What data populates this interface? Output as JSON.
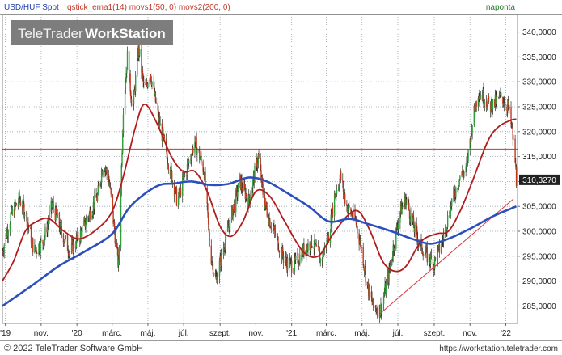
{
  "chart_data": {
    "type": "candlestick",
    "header": {
      "instrument": "USD/HUF Spot",
      "indicators": "qstick_ema1(14) movs1(50, 0) movs2(200, 0)",
      "period": "naponta"
    },
    "watermark": {
      "brand": "TeleTrader",
      "product": "WorkStation"
    },
    "footer": {
      "copyright": "© 2022 TeleTrader Software GmbH",
      "url": "https://workstation.teletrader.com"
    },
    "ylim": [
      281.5,
      343.5
    ],
    "yticks": [
      {
        "value": 285,
        "label": "285,0000"
      },
      {
        "value": 290,
        "label": "290,0000"
      },
      {
        "value": 295,
        "label": "295,0000"
      },
      {
        "value": 300,
        "label": "300,0000"
      },
      {
        "value": 305,
        "label": "305,0000"
      },
      {
        "value": 310,
        "label": "310,0000"
      },
      {
        "value": 315,
        "label": "315,0000"
      },
      {
        "value": 320,
        "label": "320,0000"
      },
      {
        "value": 325,
        "label": "325,0000"
      },
      {
        "value": 330,
        "label": "330,0000"
      },
      {
        "value": 335,
        "label": "335,0000"
      },
      {
        "value": 340,
        "label": "340,0000"
      }
    ],
    "xlim": [
      "2019-08-27",
      "2022-01-21"
    ],
    "xticks": [
      {
        "date": "2019-09-01",
        "label": "'19"
      },
      {
        "date": "2019-11-01",
        "label": "nov."
      },
      {
        "date": "2020-01-01",
        "label": "'20"
      },
      {
        "date": "2020-03-01",
        "label": "márc."
      },
      {
        "date": "2020-05-01",
        "label": "máj."
      },
      {
        "date": "2020-07-01",
        "label": "júl."
      },
      {
        "date": "2020-09-01",
        "label": "szept."
      },
      {
        "date": "2020-11-01",
        "label": "nov."
      },
      {
        "date": "2021-01-01",
        "label": "'21"
      },
      {
        "date": "2021-03-01",
        "label": "márc."
      },
      {
        "date": "2021-05-01",
        "label": "máj."
      },
      {
        "date": "2021-07-01",
        "label": "júl."
      },
      {
        "date": "2021-09-01",
        "label": "szept."
      },
      {
        "date": "2021-11-01",
        "label": "nov."
      },
      {
        "date": "2022-01-01",
        "label": "'22"
      }
    ],
    "last_price": {
      "value": 310.327,
      "label": "310,3270"
    },
    "horizontal_line": {
      "value": 316.5,
      "color": "#c0392b"
    },
    "trendline": {
      "points": [
        [
          "2021-06-01",
          283.5
        ],
        [
          "2022-01-14",
          306.5
        ]
      ],
      "color": "#d9383a"
    },
    "price_path": [
      [
        "2019-08-27",
        296.0
      ],
      [
        "2019-09-10",
        303.0
      ],
      [
        "2019-09-25",
        306.5
      ],
      [
        "2019-10-05",
        304.0
      ],
      [
        "2019-10-20",
        296.0
      ],
      [
        "2019-11-05",
        298.0
      ],
      [
        "2019-11-20",
        305.5
      ],
      [
        "2019-12-05",
        300.0
      ],
      [
        "2019-12-20",
        296.0
      ],
      [
        "2020-01-05",
        299.0
      ],
      [
        "2020-01-20",
        303.0
      ],
      [
        "2020-02-05",
        307.0
      ],
      [
        "2020-02-15",
        314.0
      ],
      [
        "2020-02-25",
        310.0
      ],
      [
        "2020-03-05",
        300.0
      ],
      [
        "2020-03-12",
        293.0
      ],
      [
        "2020-03-20",
        325.0
      ],
      [
        "2020-03-27",
        335.0
      ],
      [
        "2020-04-05",
        324.0
      ],
      [
        "2020-04-15",
        337.0
      ],
      [
        "2020-04-25",
        328.0
      ],
      [
        "2020-05-05",
        332.0
      ],
      [
        "2020-05-20",
        322.0
      ],
      [
        "2020-06-05",
        314.0
      ],
      [
        "2020-06-20",
        306.0
      ],
      [
        "2020-07-05",
        312.0
      ],
      [
        "2020-07-20",
        318.0
      ],
      [
        "2020-08-05",
        312.0
      ],
      [
        "2020-08-15",
        296.0
      ],
      [
        "2020-08-25",
        290.0
      ],
      [
        "2020-09-05",
        296.0
      ],
      [
        "2020-09-20",
        303.0
      ],
      [
        "2020-10-05",
        310.0
      ],
      [
        "2020-10-20",
        306.0
      ],
      [
        "2020-11-05",
        315.0
      ],
      [
        "2020-11-15",
        306.0
      ],
      [
        "2020-11-25",
        302.0
      ],
      [
        "2020-12-05",
        299.0
      ],
      [
        "2020-12-20",
        294.0
      ],
      [
        "2021-01-05",
        293.0
      ],
      [
        "2021-01-20",
        296.0
      ],
      [
        "2021-02-05",
        298.0
      ],
      [
        "2021-02-20",
        294.0
      ],
      [
        "2021-03-05",
        299.0
      ],
      [
        "2021-03-15",
        307.0
      ],
      [
        "2021-03-25",
        311.0
      ],
      [
        "2021-04-05",
        305.0
      ],
      [
        "2021-04-20",
        302.0
      ],
      [
        "2021-05-01",
        296.0
      ],
      [
        "2021-05-10",
        289.0
      ],
      [
        "2021-05-20",
        285.0
      ],
      [
        "2021-06-01",
        284.0
      ],
      [
        "2021-06-15",
        291.0
      ],
      [
        "2021-06-25",
        298.0
      ],
      [
        "2021-07-05",
        304.0
      ],
      [
        "2021-07-15",
        306.5
      ],
      [
        "2021-07-25",
        302.0
      ],
      [
        "2021-08-05",
        298.0
      ],
      [
        "2021-08-20",
        295.0
      ],
      [
        "2021-09-01",
        293.5
      ],
      [
        "2021-09-15",
        298.0
      ],
      [
        "2021-10-01",
        306.0
      ],
      [
        "2021-10-15",
        311.0
      ],
      [
        "2021-10-25",
        312.0
      ],
      [
        "2021-11-05",
        322.0
      ],
      [
        "2021-11-15",
        328.0
      ],
      [
        "2021-11-25",
        327.0
      ],
      [
        "2021-12-05",
        325.0
      ],
      [
        "2021-12-15",
        326.0
      ],
      [
        "2021-12-25",
        327.0
      ],
      [
        "2022-01-05",
        325.0
      ],
      [
        "2022-01-12",
        320.0
      ],
      [
        "2022-01-17",
        314.0
      ],
      [
        "2022-01-19",
        310.3
      ]
    ],
    "series": [
      {
        "name": "movs1(50, 0)",
        "color": "#b01c1c",
        "points": [
          [
            "2019-08-27",
            290.0
          ],
          [
            "2019-09-15",
            294.0
          ],
          [
            "2019-10-05",
            300.0
          ],
          [
            "2019-10-25",
            302.0
          ],
          [
            "2019-11-15",
            302.5
          ],
          [
            "2019-12-10",
            300.0
          ],
          [
            "2020-01-05",
            298.5
          ],
          [
            "2020-02-05",
            300.5
          ],
          [
            "2020-03-01",
            304.0
          ],
          [
            "2020-03-20",
            311.0
          ],
          [
            "2020-04-10",
            321.0
          ],
          [
            "2020-04-25",
            325.5
          ],
          [
            "2020-05-15",
            322.0
          ],
          [
            "2020-06-10",
            315.0
          ],
          [
            "2020-06-30",
            312.0
          ],
          [
            "2020-07-20",
            312.0
          ],
          [
            "2020-08-10",
            308.0
          ],
          [
            "2020-09-01",
            301.0
          ],
          [
            "2020-09-20",
            299.0
          ],
          [
            "2020-10-10",
            302.0
          ],
          [
            "2020-11-01",
            308.0
          ],
          [
            "2020-11-25",
            307.0
          ],
          [
            "2020-12-20",
            302.0
          ],
          [
            "2021-01-20",
            296.0
          ],
          [
            "2021-02-15",
            295.0
          ],
          [
            "2021-03-10",
            299.0
          ],
          [
            "2021-04-05",
            303.0
          ],
          [
            "2021-04-25",
            304.0
          ],
          [
            "2021-05-15",
            300.0
          ],
          [
            "2021-06-05",
            294.0
          ],
          [
            "2021-06-25",
            292.0
          ],
          [
            "2021-07-15",
            293.0
          ],
          [
            "2021-08-10",
            298.0
          ],
          [
            "2021-09-05",
            299.5
          ],
          [
            "2021-09-25",
            300.0
          ],
          [
            "2021-10-15",
            304.0
          ],
          [
            "2021-11-05",
            310.0
          ],
          [
            "2021-12-01",
            318.0
          ],
          [
            "2021-12-20",
            321.0
          ],
          [
            "2022-01-10",
            322.3
          ],
          [
            "2022-01-19",
            322.5
          ]
        ]
      },
      {
        "name": "movs2(200, 0)",
        "color": "#2b4fbf",
        "points": [
          [
            "2019-08-27",
            285.0
          ],
          [
            "2019-10-15",
            289.0
          ],
          [
            "2019-12-01",
            293.0
          ],
          [
            "2020-01-15",
            296.0
          ],
          [
            "2020-03-01",
            299.5
          ],
          [
            "2020-04-01",
            305.0
          ],
          [
            "2020-05-15",
            309.0
          ],
          [
            "2020-06-15",
            309.6
          ],
          [
            "2020-07-15",
            310.0
          ],
          [
            "2020-08-15",
            309.3
          ],
          [
            "2020-09-15",
            309.5
          ],
          [
            "2020-10-20",
            310.8
          ],
          [
            "2020-11-20",
            310.0
          ],
          [
            "2020-12-20",
            308.0
          ],
          [
            "2021-01-30",
            305.0
          ],
          [
            "2021-03-05",
            302.0
          ],
          [
            "2021-04-10",
            302.5
          ],
          [
            "2021-05-10",
            301.5
          ],
          [
            "2021-06-20",
            300.0
          ],
          [
            "2021-07-25",
            298.5
          ],
          [
            "2021-08-25",
            297.5
          ],
          [
            "2021-09-25",
            298.5
          ],
          [
            "2021-11-01",
            300.5
          ],
          [
            "2021-12-10",
            303.0
          ],
          [
            "2022-01-19",
            305.0
          ]
        ]
      }
    ]
  }
}
